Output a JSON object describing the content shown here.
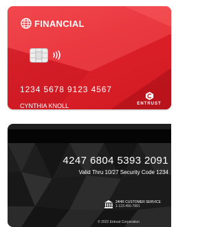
{
  "front": {
    "brand_name": "FINANCIAL",
    "card_number": "1234 5678 9123 4567",
    "holder_name": "CYNTHIA KNOLL",
    "issuer_logo_text": "ENTRUST",
    "colors": {
      "card": "#e3262e",
      "text": "#ffffff"
    },
    "icons": [
      "globe-icon",
      "chip-icon",
      "contactless-icon",
      "entrust-logo-icon"
    ]
  },
  "back": {
    "card_number": "4247 6804 5393 2091",
    "validity_line": "Valid Thru 10/27   Security Code 1234",
    "service_label": "24HR CUSTOMER SERVICE",
    "service_phone": "1-123-456-7891",
    "copyright": "© 2022 Entrust Corporation",
    "colors": {
      "card": "#1e1e1e",
      "stripe": "#050505",
      "text": "#ffffff"
    },
    "icons": [
      "bank-icon"
    ]
  }
}
